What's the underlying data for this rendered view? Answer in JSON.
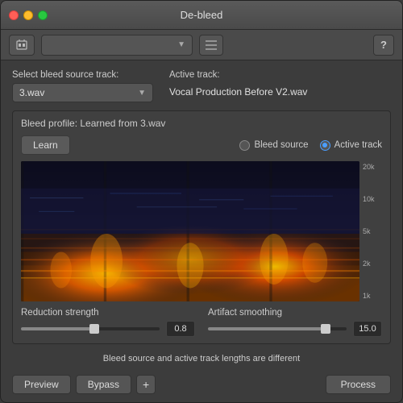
{
  "window": {
    "title": "De-bleed"
  },
  "toolbar": {
    "help_label": "?"
  },
  "track_section": {
    "bleed_label": "Select bleed source track:",
    "bleed_value": "3.wav",
    "active_label": "Active track:",
    "active_value": "Vocal Production Before V2.wav"
  },
  "bleed_profile": {
    "label": "Bleed profile:  Learned from 3.wav",
    "learn_btn": "Learn",
    "radio_bleed": "Bleed source",
    "radio_active": "Active track",
    "selected": "active"
  },
  "freq_labels": [
    "20k",
    "10k",
    "5k",
    "2k",
    "1k"
  ],
  "sliders": {
    "reduction_label": "Reduction strength",
    "reduction_value": "0.8",
    "reduction_percent": 53,
    "artifact_label": "Artifact smoothing",
    "artifact_value": "15.0",
    "artifact_percent": 85
  },
  "warning": {
    "text": "Bleed source and active track lengths are different"
  },
  "bottom": {
    "preview": "Preview",
    "bypass": "Bypass",
    "plus": "+",
    "process": "Process"
  }
}
